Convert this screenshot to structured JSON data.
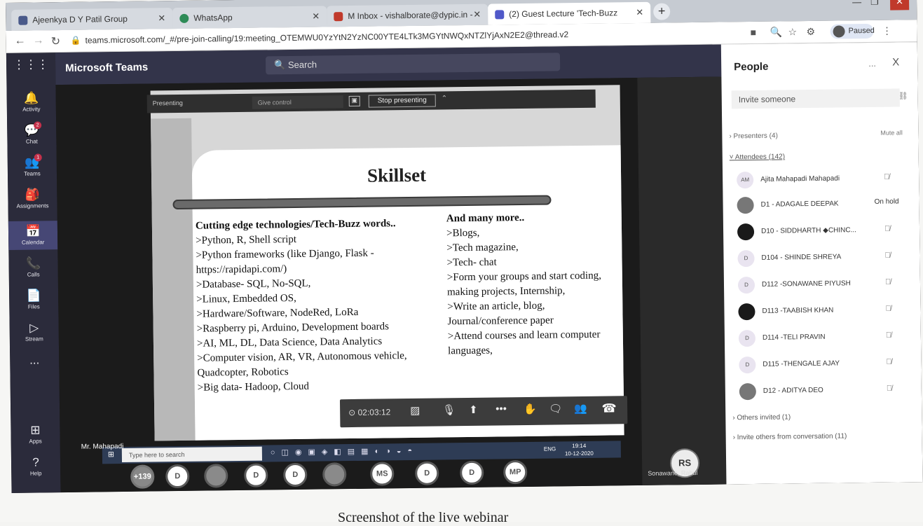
{
  "browser": {
    "tabs": [
      {
        "title": "Ajeenkya D Y Patil Group",
        "favicon_color": "#4a5a8a"
      },
      {
        "title": "WhatsApp",
        "favicon_color": "#2e8b57"
      },
      {
        "title": "M Inbox - vishalborate@dypic.in -",
        "favicon_color": "#c0392b"
      },
      {
        "title": "(2) Guest Lecture 'Tech-Buzz",
        "favicon_color": "#5059c9",
        "active": true
      }
    ],
    "new_tab": "+",
    "url": "teams.microsoft.com/_#/pre-join-calling/19:meeting_OTEMWU0YzYtN2YzNC00YTE4LTk3MGYtNWQxNTZlYjAxN2E2@thread.v2",
    "profile": "Paused"
  },
  "teams": {
    "app_title": "Microsoft Teams",
    "search_placeholder": "Search",
    "rail": [
      {
        "label": "Activity",
        "icon": "bell-icon"
      },
      {
        "label": "Chat",
        "icon": "chat-icon",
        "badge": "2"
      },
      {
        "label": "Teams",
        "icon": "teams-icon",
        "badge": "1"
      },
      {
        "label": "Assignments",
        "icon": "assignments-icon"
      },
      {
        "label": "Calendar",
        "icon": "calendar-icon"
      },
      {
        "label": "Calls",
        "icon": "phone-icon"
      },
      {
        "label": "Files",
        "icon": "files-icon"
      },
      {
        "label": "Stream",
        "icon": "stream-icon"
      },
      {
        "label": "...",
        "icon": "more-icon"
      },
      {
        "label": "Apps",
        "icon": "apps-icon"
      },
      {
        "label": "Help",
        "icon": "help-icon"
      }
    ]
  },
  "presenting_bar": {
    "label": "Presenting",
    "select": "Give control",
    "stop": "Stop presenting"
  },
  "slide": {
    "title": "Skillset",
    "left_heading": "Cutting edge technologies/Tech-Buzz words..",
    "left_items": [
      ">Python, R,  Shell script",
      ">Python frameworks (like Django, Flask - https://rapidapi.com/)",
      ">Database- SQL, No-SQL,",
      ">Linux, Embedded OS,",
      ">Hardware/Software, NodeRed, LoRa",
      ">Raspberry pi, Arduino, Development boards",
      ">AI, ML, DL, Data Science, Data Analytics",
      ">Computer vision, AR, VR, Autonomous vehicle, Quadcopter, Robotics",
      ">Big data- Hadoop, Cloud"
    ],
    "right_heading": "And many more..",
    "right_items": [
      ">Blogs,",
      ">Tech magazine,",
      ">Tech- chat",
      ">Form your groups and start coding, making projects, Internship,",
      ">Write an article, blog, Journal/conference paper",
      ">Attend courses and learn computer languages,"
    ]
  },
  "call_controls": {
    "timer": "02:03:12"
  },
  "taskbar": {
    "search_placeholder": "Type here to search",
    "time": "19:14",
    "date": "10-12-2020",
    "lang": "ENG"
  },
  "presenter_name": "Mr. Mahapadi",
  "participants": [
    "+139",
    "D",
    "",
    "D",
    "D",
    "",
    "MS",
    "D",
    "D",
    "MP"
  ],
  "self_tile": {
    "initials": "RS",
    "name": "Sonawane, Rahul"
  },
  "people_panel": {
    "title": "People",
    "more": "...",
    "close": "X",
    "invite_placeholder": "Invite someone",
    "presenters": "Presenters (4)",
    "mute_all": "Mute all",
    "attendees": "Attendees (142)",
    "people": [
      {
        "initials": "AM",
        "name": "Ajita Mahapadi Mahapadi",
        "state": "muted"
      },
      {
        "initials": "",
        "name": "D1 - ADAGALE DEEPAK",
        "state": "On hold",
        "pic": "photo"
      },
      {
        "initials": "",
        "name": "D10 - SIDDHARTH ◆CHINC...",
        "state": "muted",
        "pic": "dark"
      },
      {
        "initials": "D",
        "name": "D104 - SHINDE SHREYA",
        "state": "muted"
      },
      {
        "initials": "D",
        "name": "D112 -SONAWANE PIYUSH",
        "state": "muted"
      },
      {
        "initials": "",
        "name": "D113 -TAABISH KHAN",
        "state": "muted",
        "pic": "dark"
      },
      {
        "initials": "D",
        "name": "D114 -TELI PRAVIN",
        "state": "muted"
      },
      {
        "initials": "D",
        "name": "D115 -THENGALE AJAY",
        "state": "muted"
      },
      {
        "initials": "",
        "name": "D12 - ADITYA DEO",
        "state": "muted",
        "pic": "photo"
      }
    ],
    "others_invited": "Others invited (1)",
    "invite_others": "Invite others from conversation (11)"
  },
  "caption": "Screenshot of the live webinar"
}
